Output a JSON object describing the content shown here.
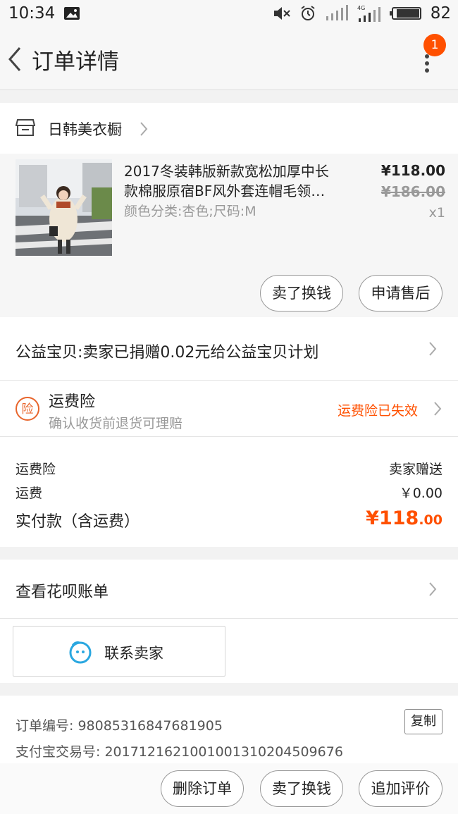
{
  "status_bar": {
    "time": "10:34",
    "battery": "82"
  },
  "header": {
    "title": "订单详情",
    "badge_count": "1"
  },
  "shop": {
    "name": "日韩美衣橱"
  },
  "item": {
    "title_line1": "2017冬装韩版新款宽松加厚中长",
    "title_line2": "款棉服原宿BF风外套连帽毛领…",
    "sku": "颜色分类:杏色;尺码:M",
    "price": "¥118.00",
    "original_price": "¥186.00",
    "quantity": "x1",
    "buttons": [
      "卖了换钱",
      "申请售后"
    ]
  },
  "charity": {
    "text": "公益宝贝:卖家已捐赠0.02元给公益宝贝计划"
  },
  "insurance": {
    "icon_char": "险",
    "title": "运费险",
    "subtitle": "确认收货前退货可理赔",
    "status": "运费险已失效"
  },
  "fees": {
    "rows": [
      {
        "label": "运费险",
        "value": "卖家赠送"
      },
      {
        "label": "运费",
        "value": "￥0.00"
      }
    ],
    "total_label": "实付款（含运费）",
    "total_int": "¥118",
    "total_dec": ".00"
  },
  "huabei": {
    "text": "查看花呗账单"
  },
  "contact": {
    "label": "联系卖家"
  },
  "order_info": {
    "order_no": "订单编号: 98085316847681905",
    "alipay_no": "支付宝交易号: 2017121621001001310204509676",
    "copy_label": "复制"
  },
  "bottom_buttons": [
    "删除订单",
    "卖了换钱",
    "追加评价"
  ],
  "colors": {
    "accent": "#ff5000",
    "insurance_icon": "#e8652c",
    "contact_icon": "#2aa7e0"
  }
}
